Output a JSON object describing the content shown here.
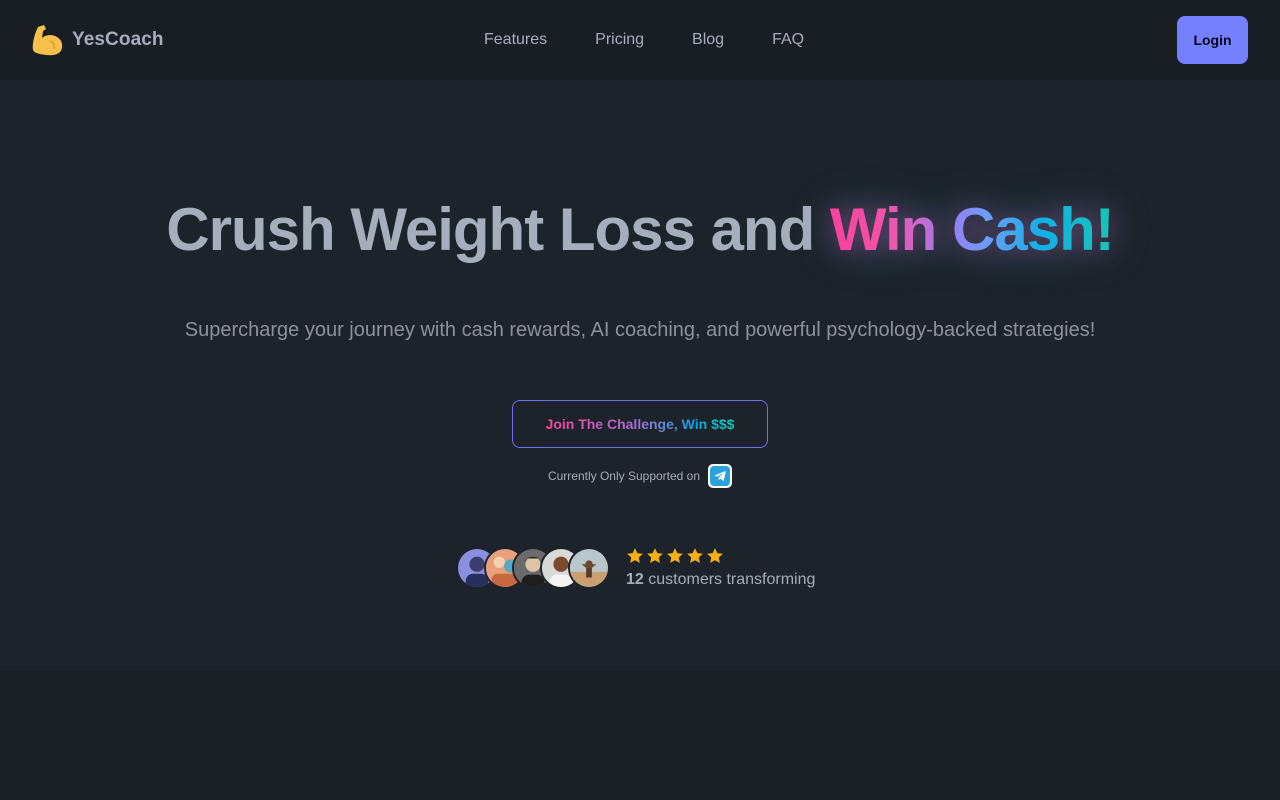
{
  "nav": {
    "brand": "YesCoach",
    "brand_icon": "flexed-biceps-icon",
    "links": [
      "Features",
      "Pricing",
      "Blog",
      "FAQ"
    ],
    "login_label": "Login"
  },
  "hero": {
    "title_plain": "Crush Weight Loss and ",
    "title_highlight": "Win Cash!",
    "subtitle": "Supercharge your journey with cash rewards, AI coaching, and powerful psychology-backed strategies!",
    "cta_label": "Join The Challenge, Win $$$",
    "support_text": "Currently Only Supported on",
    "support_icon": "telegram-icon"
  },
  "social_proof": {
    "rating_stars": 5,
    "customer_count": "12",
    "customer_suffix": " customers transforming",
    "avatar_count": 5
  },
  "colors": {
    "background": "#1d232a",
    "navbar": "#191e24",
    "primary": "#7480ff",
    "text": "#a6adbb",
    "star": "#f5b013",
    "gradient_start": "#f9429e",
    "gradient_end": "#19c4b4"
  }
}
